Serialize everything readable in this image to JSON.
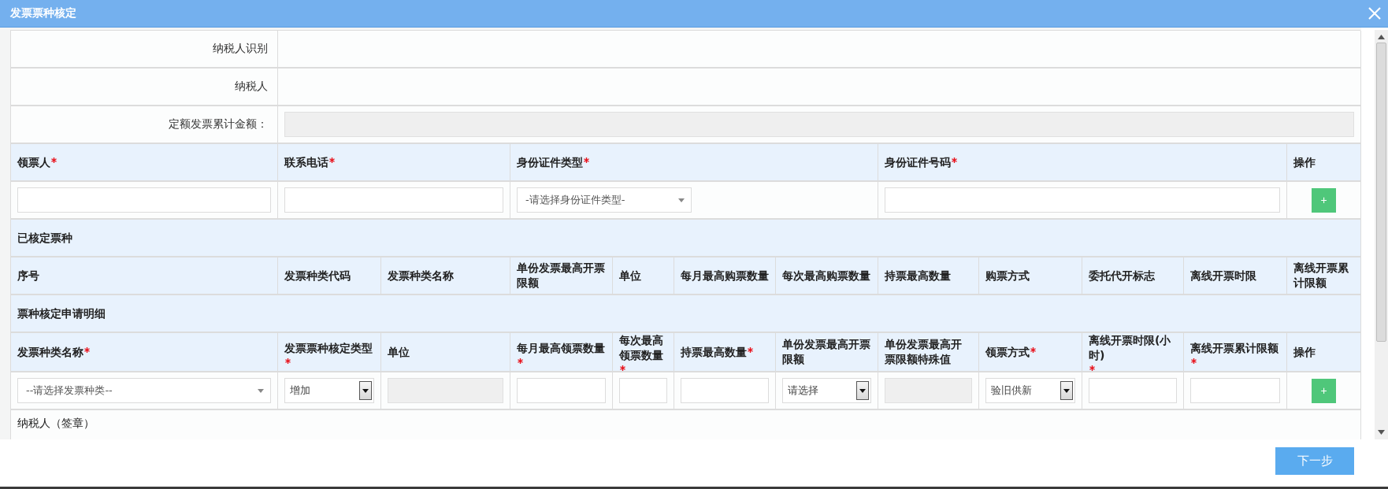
{
  "window": {
    "title": "发票票种核定"
  },
  "taxpayer_info": [
    {
      "label": "纳税人识别",
      "kind": "blank"
    },
    {
      "label": "纳税人",
      "kind": "blank"
    },
    {
      "label": "定额发票累计金额：",
      "kind": "disabled"
    }
  ],
  "recipient": {
    "columns": [
      {
        "label": "领票人",
        "required": true
      },
      {
        "label": "联系电话",
        "required": true
      },
      {
        "label": "身份证件类型",
        "required": true
      },
      {
        "label": "身份证件号码",
        "required": true
      },
      {
        "label": "操作",
        "required": false
      }
    ],
    "row": [
      {
        "kind": "text"
      },
      {
        "kind": "text"
      },
      {
        "kind": "select",
        "value": "-请选择身份证件类型-"
      },
      {
        "kind": "text"
      },
      {
        "kind": "add",
        "label": "+"
      }
    ]
  },
  "approved_types": {
    "title": "已核定票种",
    "columns": [
      {
        "label": "序号",
        "required": false
      },
      {
        "label": "发票种类代码",
        "required": false
      },
      {
        "label": "发票种类名称",
        "required": false
      },
      {
        "label": "单份发票最高开票限额",
        "required": false
      },
      {
        "label": "单位",
        "required": false
      },
      {
        "label": "每月最高购票数量",
        "required": false
      },
      {
        "label": "每次最高购票数量",
        "required": false
      },
      {
        "label": "持票最高数量",
        "required": false
      },
      {
        "label": "购票方式",
        "required": false
      },
      {
        "label": "委托代开标志",
        "required": false
      },
      {
        "label": "离线开票时限",
        "required": false
      },
      {
        "label": "离线开票累计限额",
        "required": false
      }
    ]
  },
  "application_details": {
    "title": "票种核定申请明细",
    "columns": [
      {
        "label": "发票种类名称",
        "required": true
      },
      {
        "label": "发票票种核定类型",
        "required": true
      },
      {
        "label": "单位",
        "required": false
      },
      {
        "label": "每月最高领票数量",
        "required": true
      },
      {
        "label": "每次最高领票数量",
        "required": true
      },
      {
        "label": "持票最高数量",
        "required": true
      },
      {
        "label": "单份发票最高开票限额",
        "required": false
      },
      {
        "label": "单份发票最高开票限额特殊值",
        "required": false
      },
      {
        "label": "领票方式",
        "required": true
      },
      {
        "label": "离线开票时限(小时)",
        "required": true
      },
      {
        "label": "离线开票累计限额",
        "required": true
      },
      {
        "label": "操作",
        "required": false
      }
    ],
    "row": [
      {
        "kind": "select",
        "value": "--请选择发票种类--"
      },
      {
        "kind": "combo",
        "value": "增加"
      },
      {
        "kind": "disabled"
      },
      {
        "kind": "text"
      },
      {
        "kind": "text"
      },
      {
        "kind": "text"
      },
      {
        "kind": "combo",
        "value": "请选择"
      },
      {
        "kind": "disabled"
      },
      {
        "kind": "combo",
        "value": "验旧供新"
      },
      {
        "kind": "text"
      },
      {
        "kind": "text"
      },
      {
        "kind": "add",
        "label": "+"
      }
    ]
  },
  "signature": "纳税人（签章）",
  "footer": {
    "next_button": "下一步"
  }
}
